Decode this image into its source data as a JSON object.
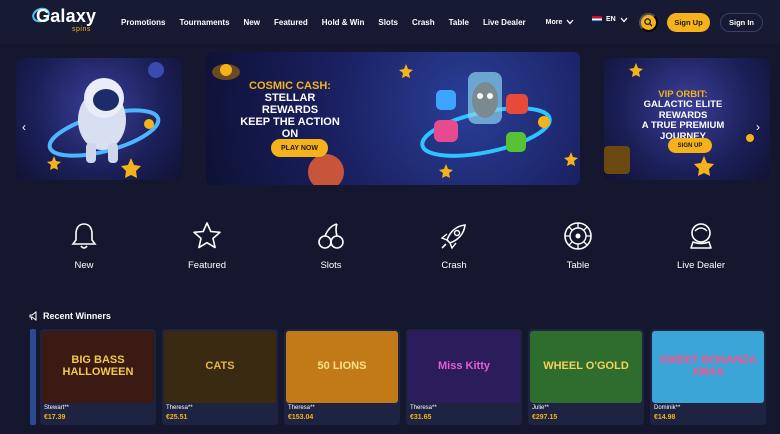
{
  "brand": {
    "logo_main": "Galaxy",
    "logo_sub": "spins"
  },
  "nav": {
    "items": [
      "Promotions",
      "Tournaments",
      "New",
      "Featured",
      "Hold & Win",
      "Slots",
      "Crash",
      "Table",
      "Live Dealer"
    ],
    "more_label": "More"
  },
  "header": {
    "lang": "EN",
    "signup_label": "Sign Up",
    "signin_label": "Sign In"
  },
  "colors": {
    "accent": "#f6b21b",
    "background": "#14172e",
    "header": "#161a33",
    "card": "#1f2342"
  },
  "carousel": {
    "main": {
      "title_line1": "COSMIC CASH:",
      "title_line2": "STELLAR REWARDS",
      "title_line3": "KEEP THE ACTION ON",
      "button": "PLAY NOW"
    },
    "right": {
      "title_line1": "VIP ORBIT:",
      "title_line2": "GALACTIC ELITE REWARDS",
      "title_line3": "A TRUE PREMIUM JOURNEY",
      "button": "SIGN UP"
    }
  },
  "categories": [
    {
      "label": "New",
      "icon": "bell-icon"
    },
    {
      "label": "Featured",
      "icon": "star-icon"
    },
    {
      "label": "Slots",
      "icon": "cherries-icon"
    },
    {
      "label": "Crash",
      "icon": "rocket-icon"
    },
    {
      "label": "Table",
      "icon": "roulette-icon"
    },
    {
      "label": "Live Dealer",
      "icon": "dealer-icon"
    }
  ],
  "recent_winners": {
    "title": "Recent Winners",
    "items": [
      {
        "game": "BIG BASS HALLOWEEN",
        "name": "Stewart**",
        "amount": "€17.39",
        "bg": "#3a1a12",
        "fg": "#f2c94c"
      },
      {
        "game": "CATS",
        "name": "Theresa**",
        "amount": "€25.51",
        "bg": "#3b2a12",
        "fg": "#e6b54a"
      },
      {
        "game": "50 LIONS",
        "name": "Theresa**",
        "amount": "€153.04",
        "bg": "#c27a18",
        "fg": "#ffe08a"
      },
      {
        "game": "Miss Kitty",
        "name": "Theresa**",
        "amount": "€31.65",
        "bg": "#2b1c5c",
        "fg": "#e85cd6"
      },
      {
        "game": "WHEEL O'GOLD",
        "name": "Julie**",
        "amount": "€297.15",
        "bg": "#2f6d2f",
        "fg": "#f6d25a"
      },
      {
        "game": "SWEET BONANZA XMAS",
        "name": "Dominik**",
        "amount": "€14.98",
        "bg": "#3aa6d8",
        "fg": "#ff4f8b"
      }
    ]
  }
}
